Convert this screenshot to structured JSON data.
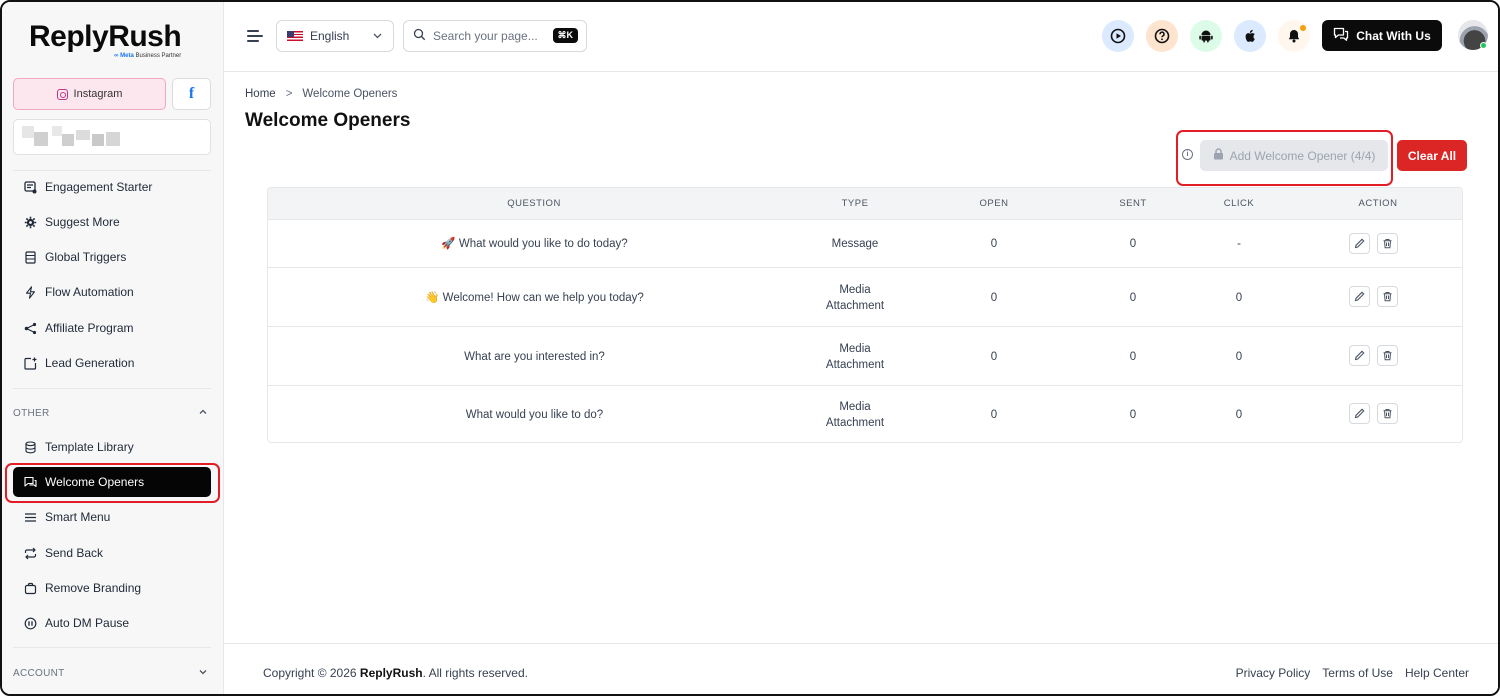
{
  "brand": {
    "name": "ReplyRush",
    "subtitle": "Meta Business Partner",
    "meta_word": "∞ Meta",
    "sub_rest": " Business Partner"
  },
  "account_tabs": {
    "instagram": "Instagram",
    "facebook": "f"
  },
  "sidebar": {
    "items": [
      {
        "label": "Engagement Starter",
        "icon": "engagement-icon"
      },
      {
        "label": "Suggest More",
        "icon": "gear-icon"
      },
      {
        "label": "Global Triggers",
        "icon": "list-icon"
      },
      {
        "label": "Flow Automation",
        "icon": "bolt-icon"
      },
      {
        "label": "Affiliate Program",
        "icon": "share-icon"
      },
      {
        "label": "Lead Generation",
        "icon": "lead-icon"
      }
    ],
    "other_label": "OTHER",
    "other_items": [
      {
        "label": "Template Library",
        "icon": "database-icon"
      },
      {
        "label": "Welcome Openers",
        "icon": "chat-icon",
        "active": true
      },
      {
        "label": "Smart Menu",
        "icon": "menu-icon"
      },
      {
        "label": "Send Back",
        "icon": "repeat-icon"
      },
      {
        "label": "Remove Branding",
        "icon": "tag-icon"
      },
      {
        "label": "Auto DM Pause",
        "icon": "pause-icon"
      }
    ],
    "account_label": "ACCOUNT"
  },
  "topbar": {
    "language": "English",
    "search_placeholder": "Search your page...",
    "shortcut": "⌘K",
    "chat_button": "Chat With Us",
    "icons": [
      "play-icon",
      "help-icon",
      "android-icon",
      "apple-icon",
      "bell-icon"
    ]
  },
  "breadcrumb": {
    "home": "Home",
    "separator": ">",
    "current": "Welcome Openers"
  },
  "page_title": "Welcome Openers",
  "actions": {
    "add_label": "Add Welcome Opener (4/4)",
    "clear_label": "Clear All"
  },
  "table": {
    "headers": [
      "QUESTION",
      "TYPE",
      "OPEN",
      "SENT",
      "CLICK",
      "ACTION"
    ],
    "rows": [
      {
        "question": "🚀 What would you like to do today?",
        "type": "Message",
        "open": "0",
        "sent": "0",
        "click": "-"
      },
      {
        "question": "👋 Welcome! How can we help you today?",
        "type": "Media\nAttachment",
        "open": "0",
        "sent": "0",
        "click": "0"
      },
      {
        "question": "What are you interested in?",
        "type": "Media\nAttachment",
        "open": "0",
        "sent": "0",
        "click": "0"
      },
      {
        "question": "What would you like to do?",
        "type": "Media\nAttachment",
        "open": "0",
        "sent": "0",
        "click": "0"
      }
    ]
  },
  "footer": {
    "copyright_prefix": "Copyright © 2026 ",
    "copyright_brand": "ReplyRush",
    "copyright_suffix": ". All rights reserved.",
    "links": [
      "Privacy Policy",
      "Terms of Use",
      "Help Center"
    ]
  },
  "colors": {
    "accent_red": "#dc2626",
    "highlight": "#e11d26",
    "dark": "#0b0b0b",
    "instagram_pink": "#fde7ef",
    "facebook_blue": "#1877f2"
  }
}
